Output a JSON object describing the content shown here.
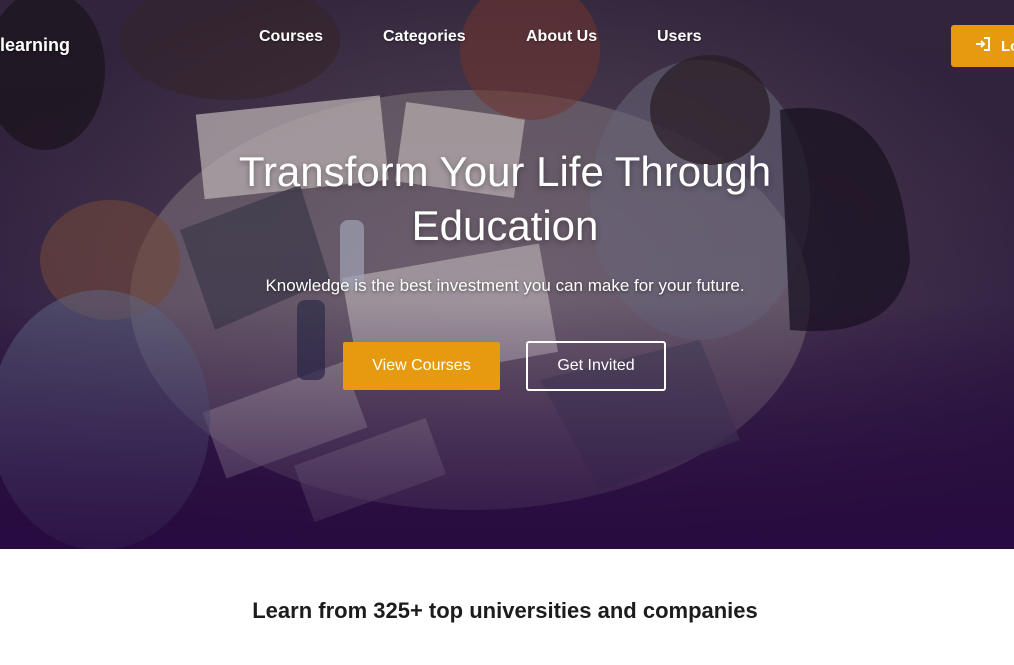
{
  "nav": {
    "brand": "-learning",
    "links": [
      "Courses",
      "Categories",
      "About Us",
      "Users"
    ],
    "login_label": "Lo"
  },
  "hero": {
    "title_line1": "Transform Your Life Through",
    "title_line2": "Education",
    "subtitle": "Knowledge is the best investment you can make for your future.",
    "primary_cta": "View Courses",
    "secondary_cta": "Get Invited"
  },
  "partners": {
    "heading": "Learn from 325+ top universities and companies"
  },
  "colors": {
    "accent": "#e59a10",
    "hero_overlay": "#2a0f3f",
    "text_dark": "#1c1c1c"
  },
  "icons": {
    "login": "sign-in-icon"
  }
}
